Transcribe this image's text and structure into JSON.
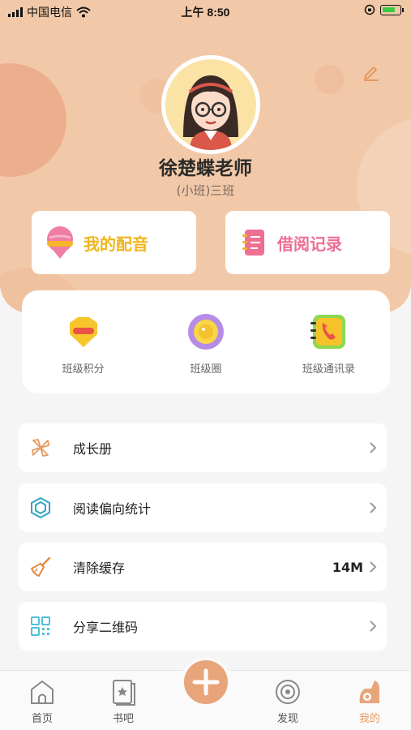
{
  "status_bar": {
    "carrier": "中国电信",
    "time": "上午 8:50"
  },
  "profile": {
    "name": "徐楚蝶老师",
    "class": "(小班)三班"
  },
  "quick_actions": [
    {
      "label": "我的配音",
      "icon": "microphone-icon"
    },
    {
      "label": "借阅记录",
      "icon": "notebook-icon"
    }
  ],
  "grid": [
    {
      "label": "班级积分",
      "icon": "points-badge-icon"
    },
    {
      "label": "班级圈",
      "icon": "class-circle-icon"
    },
    {
      "label": "班级通讯录",
      "icon": "contacts-book-icon"
    }
  ],
  "menu": [
    {
      "label": "成长册",
      "value": "",
      "icon": "pinwheel-icon"
    },
    {
      "label": "阅读偏向统计",
      "value": "",
      "icon": "hexagon-icon"
    },
    {
      "label": "清除缓存",
      "value": "14M",
      "icon": "broom-icon"
    },
    {
      "label": "分享二维码",
      "value": "",
      "icon": "qr-code-icon"
    }
  ],
  "tabs": [
    {
      "label": "首页",
      "icon": "home-icon"
    },
    {
      "label": "书吧",
      "icon": "book-icon"
    },
    {
      "label": "",
      "icon": "plus-icon"
    },
    {
      "label": "发现",
      "icon": "discover-icon"
    },
    {
      "label": "我的",
      "icon": "mine-icon"
    }
  ],
  "colors": {
    "header_bg": "#f2c9a8",
    "accent": "#e8a57a",
    "dub_text": "#f0b51c",
    "borrow_text": "#ef6f93"
  }
}
